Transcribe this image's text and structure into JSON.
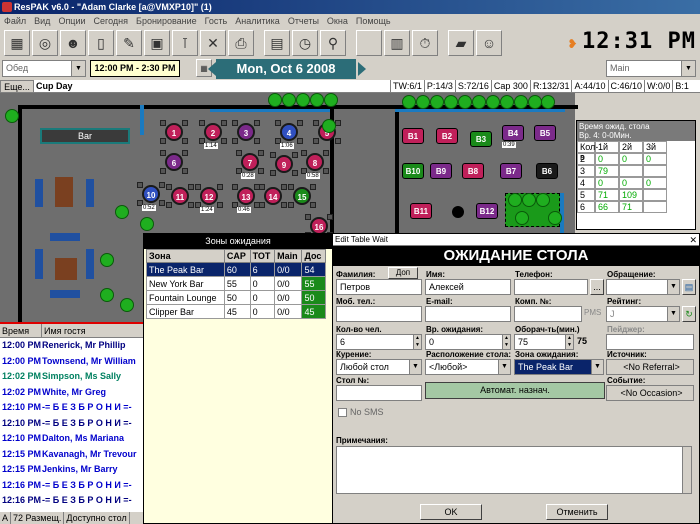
{
  "window": {
    "title": "ResPAK  v6.0 - \"Adam Clarke [a@VMXP10]\"  (1)"
  },
  "menu": [
    "Файл",
    "Вид",
    "Опции",
    "Сегодня",
    "Бронирование",
    "Гость",
    "Аналитика",
    "Отчеты",
    "Окна",
    "Помощь"
  ],
  "clock": "12:31 PM",
  "shift_select": "Обед",
  "time_range": "12:00 PM - 2:30 PM",
  "date": "Mon, Oct 6  2008",
  "room_select": "Main",
  "status": {
    "more": "Еще...",
    "day": "Cup Day",
    "stats": [
      "TW:6/1",
      "P:14/3",
      "S:72/16",
      "Cap 300",
      "R:132/31",
      "A:44/10",
      "C:46/10",
      "W:0/0",
      "B:1"
    ]
  },
  "floor": {
    "bar_label": "Bar",
    "tables": [
      {
        "id": "1",
        "color": "#c0205a"
      },
      {
        "id": "2",
        "color": "#c0205a",
        "tag": "1:14"
      },
      {
        "id": "3",
        "color": "#7b2a8a"
      },
      {
        "id": "4",
        "color": "#3050c0",
        "tag": "1:06"
      },
      {
        "id": "5",
        "color": "#c0205a"
      },
      {
        "id": "6",
        "color": "#7b2a8a"
      },
      {
        "id": "7",
        "color": "#c0205a",
        "tag": "0:28"
      },
      {
        "id": "8",
        "color": "#c0205a",
        "tag": "0:58"
      },
      {
        "id": "9",
        "color": "#c0205a"
      },
      {
        "id": "10",
        "color": "#3050c0",
        "tag": "0:52"
      },
      {
        "id": "11",
        "color": "#c0205a"
      },
      {
        "id": "12",
        "color": "#c0205a",
        "tag": "1:24"
      },
      {
        "id": "13",
        "color": "#c0205a",
        "tag": "0:46"
      },
      {
        "id": "14",
        "color": "#c0205a"
      },
      {
        "id": "15",
        "color": "#1a8a1a"
      },
      {
        "id": "16",
        "color": "#c0205a"
      }
    ],
    "booths": [
      {
        "id": "B1",
        "color": "#c0205a"
      },
      {
        "id": "B2",
        "color": "#c0205a"
      },
      {
        "id": "B3",
        "color": "#1a8a1a"
      },
      {
        "id": "B4",
        "color": "#7b2a8a",
        "tag": "0:39"
      },
      {
        "id": "B5",
        "color": "#7b2a8a"
      },
      {
        "id": "B10",
        "color": "#1a8a1a"
      },
      {
        "id": "B9",
        "color": "#7b2a8a"
      },
      {
        "id": "B8",
        "color": "#c0205a"
      },
      {
        "id": "B7",
        "color": "#7b2a8a"
      },
      {
        "id": "B6",
        "color": "#1a1a1a"
      },
      {
        "id": "B11",
        "color": "#c0205a"
      },
      {
        "id": "B12",
        "color": "#7b2a8a"
      }
    ]
  },
  "wait_panel": {
    "title": "Время ожид. стола",
    "subtitle": "Вр. 4: 0-0Мин.",
    "cols": [
      "Кол-в",
      "1й",
      "2й",
      "3й"
    ],
    "rows": [
      [
        "2",
        "0",
        "0",
        "0"
      ],
      [
        "3",
        "79",
        "",
        ""
      ],
      [
        "4",
        "0",
        "0",
        "0"
      ],
      [
        "5",
        "71",
        "109",
        ""
      ],
      [
        "6",
        "66",
        "71",
        ""
      ]
    ]
  },
  "guests": {
    "cols": [
      "Время",
      "Имя гостя"
    ],
    "rows": [
      {
        "t": "12:00 PM",
        "n": "Renerick, Mr Phillip",
        "c": "#000080"
      },
      {
        "t": "12:00 PM",
        "n": "Townsend, Mr William",
        "c": "#0000cc"
      },
      {
        "t": "12:02 PM",
        "n": "Simpson, Ms Sally",
        "c": "#008060"
      },
      {
        "t": "12:02 PM",
        "n": "White, Mr Greg",
        "c": "#0000cc"
      },
      {
        "t": "12:10 PM",
        "n": "-= Б Е З   Б Р О Н И =-",
        "c": "#0000cc"
      },
      {
        "t": "12:10 PM",
        "n": "-= Б Е З   Б Р О Н И =-",
        "c": "#000080"
      },
      {
        "t": "12:10 PM",
        "n": "Dalton, Ms Mariana",
        "c": "#0000cc"
      },
      {
        "t": "12:15 PM",
        "n": "Kavanagh, Mr Trevour",
        "c": "#0000cc"
      },
      {
        "t": "12:15 PM",
        "n": "Jenkins, Mr Barry",
        "c": "#0000cc"
      },
      {
        "t": "12:16 PM",
        "n": "-= Б Е З   Б Р О Н И =-",
        "c": "#0000cc"
      },
      {
        "t": "12:16 PM",
        "n": "-= Б Е З   Б Р О Н И =-",
        "c": "#000080"
      }
    ],
    "footer": [
      "A",
      "72 Размещ.",
      "Доступно стол"
    ]
  },
  "zones": {
    "title": "Зоны ожидания",
    "cols": [
      "Зона",
      "CAP",
      "TOT",
      "Main",
      "Дос"
    ],
    "rows": [
      {
        "name": "The Peak Bar",
        "cap": "60",
        "tot": "6",
        "main": "0/0",
        "dos": "54"
      },
      {
        "name": "New York Bar",
        "cap": "55",
        "tot": "0",
        "main": "0/0",
        "dos": "55"
      },
      {
        "name": "Fountain Lounge",
        "cap": "50",
        "tot": "0",
        "main": "0/0",
        "dos": "50"
      },
      {
        "name": "Clipper Bar",
        "cap": "45",
        "tot": "0",
        "main": "0/0",
        "dos": "45"
      }
    ]
  },
  "dialog": {
    "caption": "Edit Table Wait",
    "title": "ОЖИДАНИЕ СТОЛА",
    "labels": {
      "surname": "Фамилия:",
      "add": "Доп",
      "name": "Имя:",
      "phone": "Телефон:",
      "address": "Обращение:",
      "mobile": "Моб. тел.:",
      "email": "E-mail:",
      "company": "Комп. №:",
      "rating": "Рейтинг:",
      "count": "Кол-во чел.",
      "wait": "Вр. ожидания:",
      "turnover": "Оборач-ть(мин.)",
      "pager": "Пейджер:",
      "smoking": "Курение:",
      "location": "Расположение стола:",
      "zone": "Зона ожидания:",
      "source": "Источник:",
      "table": "Стол №:",
      "event": "Событие:",
      "nosms": "No SMS",
      "notes": "Примечания:"
    },
    "values": {
      "surname": "Петров",
      "name": "Алексей",
      "phone": "",
      "address": "",
      "mobile": "",
      "email": "",
      "company": "",
      "pms": "PMS",
      "rating": "J",
      "count": "6",
      "wait": "0",
      "turnover": "75",
      "turnover_side": "75",
      "pager": "",
      "smoking": "Любой стол",
      "location": "<Любой>",
      "zone": "The Peak Bar",
      "source": "<No Referral>",
      "table": "",
      "event": "<No Occasion>"
    },
    "auto_btn": "Автомат. назнач.",
    "ok": "OK",
    "cancel": "Отменить"
  }
}
